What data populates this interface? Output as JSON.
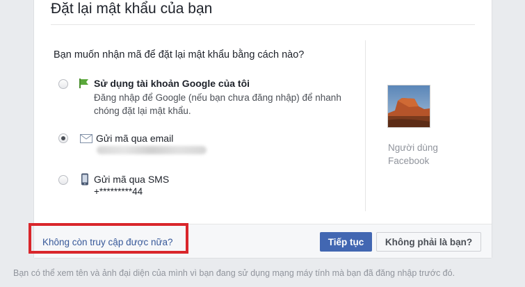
{
  "dialog": {
    "title": "Đặt lại mật khẩu của bạn",
    "question": "Bạn muốn nhận mã để đặt lại mật khẩu bằng cách nào?"
  },
  "options": [
    {
      "icon": "flag-icon",
      "title": "Sử dụng tài khoản Google của tôi",
      "description": "Đăng nhập để Google (nếu bạn chưa đăng nhập) để nhanh chóng đặt lại mật khẩu.",
      "selected": false
    },
    {
      "icon": "envelope-icon",
      "title": "Gửi mã qua email",
      "detail_redacted": true,
      "selected": true
    },
    {
      "icon": "phone-icon",
      "title": "Gửi mã qua SMS",
      "detail": "+*********44",
      "selected": false
    }
  ],
  "user": {
    "label": "Người dùng Facebook",
    "avatar": "desert-landscape-avatar"
  },
  "footer": {
    "no_access_link": "Không còn truy cập được nữa?",
    "continue_button": "Tiếp tục",
    "not_you_button": "Không phải là bạn?"
  },
  "bottom_note": "Bạn có thể xem tên và ảnh đại diện của mình vì bạn đang sử dụng mạng máy tính mà bạn đã đăng nhập trước đó.",
  "colors": {
    "primary": "#4267b2",
    "link": "#365899",
    "highlight_box": "#d9262b",
    "page_background": "#e9ebee"
  }
}
